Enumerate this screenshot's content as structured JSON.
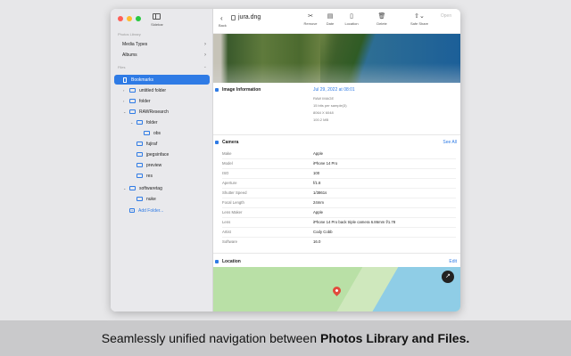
{
  "sidebar": {
    "toggle_label": "Sidebar",
    "photos_section_label": "Photos Library",
    "photos_items": [
      {
        "label": "Media Types"
      },
      {
        "label": "Albums"
      }
    ],
    "files_section_label": "Files",
    "files_items": [
      {
        "label": "Bookmarks"
      },
      {
        "label": "untitled folder"
      },
      {
        "label": "folder"
      },
      {
        "label": "RAWResearch"
      },
      {
        "label": "folder"
      },
      {
        "label": "obs"
      },
      {
        "label": "fujiraf"
      },
      {
        "label": "jpegsinface"
      },
      {
        "label": "preview"
      },
      {
        "label": "res"
      },
      {
        "label": "softwaretag"
      },
      {
        "label": "nuke"
      }
    ],
    "add_folder_label": "Add Folder..."
  },
  "toolbar": {
    "back_label": "Back",
    "title": "jura.dng",
    "tools": [
      {
        "label": "Remove",
        "icon": "remove-icon"
      },
      {
        "label": "Date",
        "icon": "calendar-icon"
      },
      {
        "label": "Location",
        "icon": "location-icon"
      },
      {
        "label": "Delete",
        "icon": "trash-icon"
      },
      {
        "label": "Safe Share",
        "icon": "share-icon"
      },
      {
        "label": "Open",
        "icon": "open-icon"
      }
    ]
  },
  "image_information": {
    "heading": "Image Information",
    "date": "Jul 29, 2022 at 08:01",
    "lines": [
      "RAW IMAGE",
      "15 bits per sample(3)",
      "8064 X 6048",
      "100.2 MB"
    ]
  },
  "camera": {
    "heading": "Camera",
    "action": "See All",
    "rows": [
      {
        "k": "Make",
        "v": "Apple"
      },
      {
        "k": "Model",
        "v": "iPhone 14 Pro"
      },
      {
        "k": "ISO",
        "v": "100"
      },
      {
        "k": "Aperture",
        "v": "f/1.8"
      },
      {
        "k": "Shutter Speed",
        "v": "1/3861s"
      },
      {
        "k": "Focal Length",
        "v": "24mm"
      },
      {
        "k": "Lens Maker",
        "v": "Apple"
      },
      {
        "k": "Lens",
        "v": "iPhone 14 Pro back triple camera 6.86mm f/1.78"
      },
      {
        "k": "Artist",
        "v": "Cody Cobb"
      },
      {
        "k": "Software",
        "v": "16.0"
      }
    ]
  },
  "location": {
    "heading": "Location",
    "action": "Edit"
  },
  "caption": {
    "part1": "Seamlessly unified navigation between",
    "part2": "Photos Library and Files."
  },
  "colors": {
    "accent": "#2f7be5",
    "pin": "#e24a3b"
  }
}
